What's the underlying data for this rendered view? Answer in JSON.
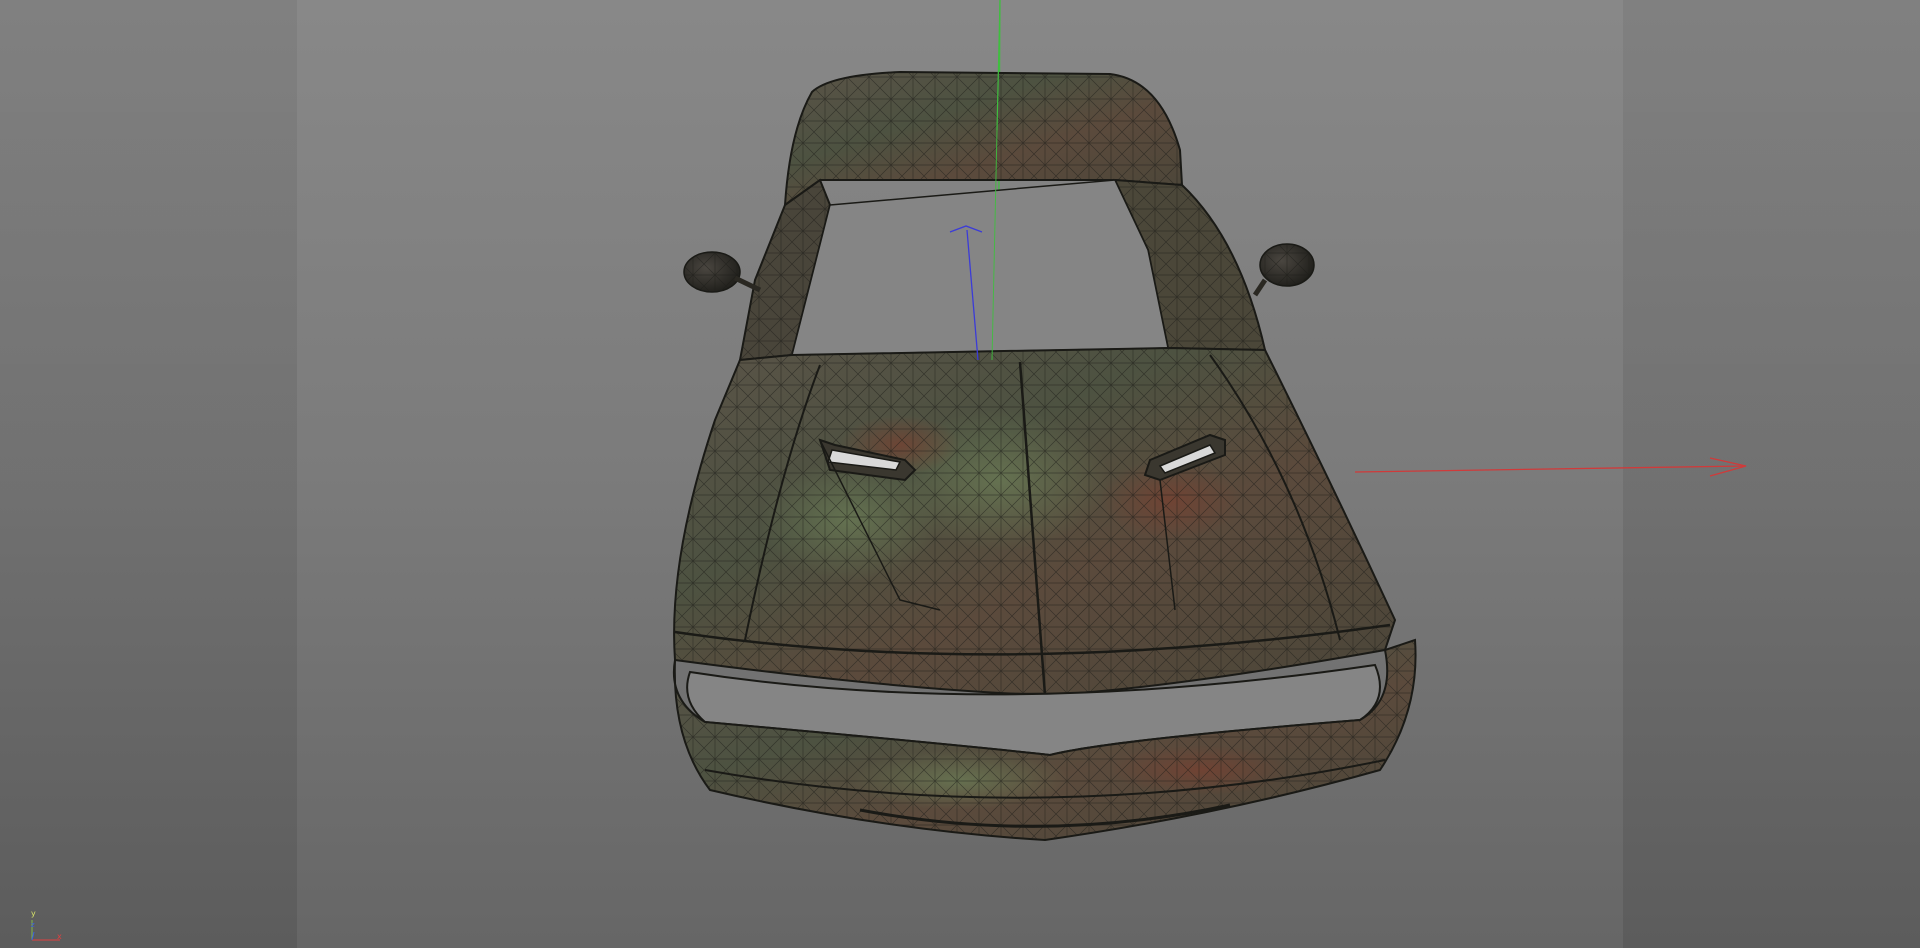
{
  "viewport": {
    "background_top": "#888888",
    "background_bottom": "#666666",
    "mesh_display": "wireframe-on-textured",
    "model": "car-body-front"
  },
  "axes": {
    "x_color": "#d03a3a",
    "y_color": "#3fbf3f",
    "z_color": "#3b3bd8",
    "mini_axis": {
      "x_label": "x",
      "y_label": "y",
      "z_label": "z"
    }
  },
  "colors": {
    "body_base": "#4f4a40",
    "body_green": "#5c6a4a",
    "body_rust": "#6e3e2e",
    "wire": "#1a1a16"
  }
}
